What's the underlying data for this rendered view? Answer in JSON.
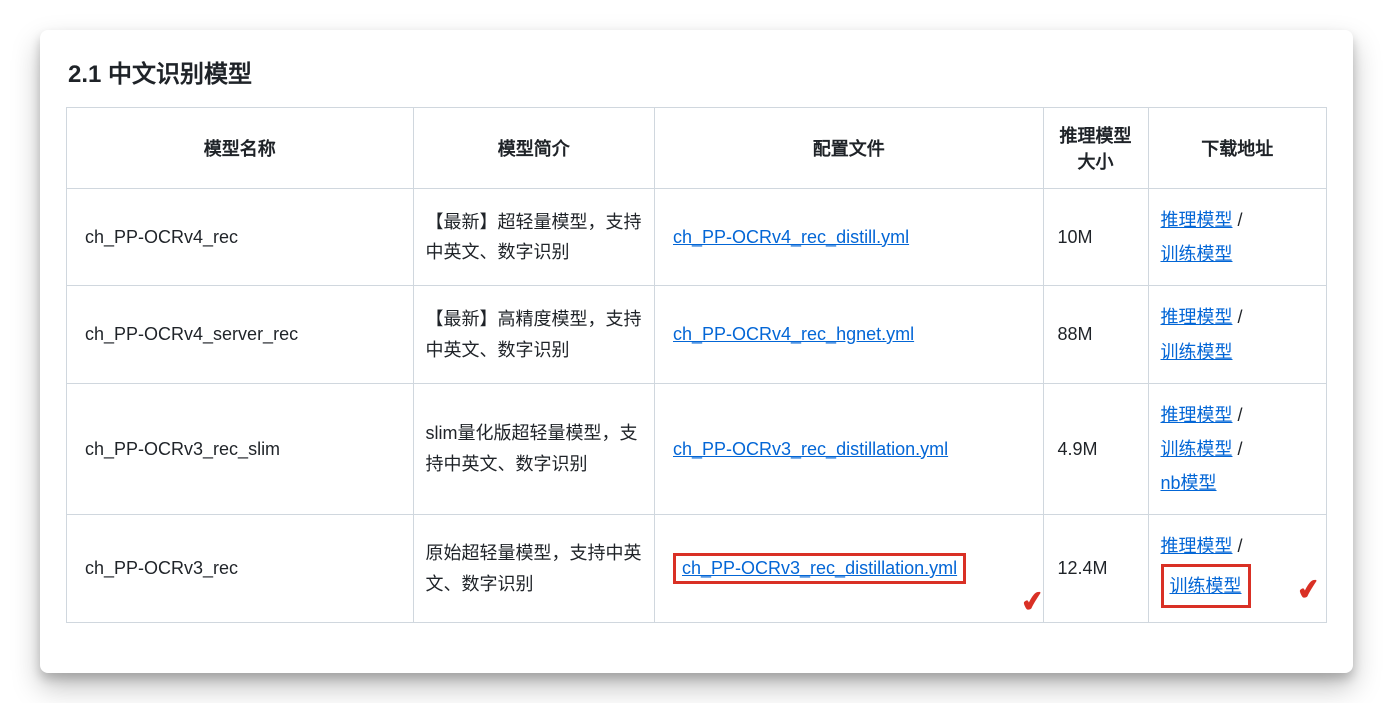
{
  "heading": "2.1 中文识别模型",
  "columns": {
    "c0": "模型名称",
    "c1": "模型简介",
    "c2": "配置文件",
    "c3": "推理模型大小",
    "c4": "下载地址"
  },
  "labels": {
    "infer": "推理模型",
    "train": "训练模型",
    "nb": "nb模型",
    "sep": " / "
  },
  "rows": [
    {
      "name": "ch_PP-OCRv4_rec",
      "intro": "【最新】超轻量模型，支持中英文、数字识别",
      "cfg": "ch_PP-OCRv4_rec_distill.yml",
      "size": "10M",
      "dl": [
        "infer",
        "train"
      ]
    },
    {
      "name": "ch_PP-OCRv4_server_rec",
      "intro": "【最新】高精度模型，支持中英文、数字识别",
      "cfg": "ch_PP-OCRv4_rec_hgnet.yml",
      "size": "88M",
      "dl": [
        "infer",
        "train"
      ]
    },
    {
      "name": "ch_PP-OCRv3_rec_slim",
      "intro": "slim量化版超轻量模型，支持中英文、数字识别",
      "cfg": "ch_PP-OCRv3_rec_distillation.yml",
      "size": "4.9M",
      "dl": [
        "infer",
        "train",
        "nb"
      ]
    },
    {
      "name": "ch_PP-OCRv3_rec",
      "intro": "原始超轻量模型，支持中英文、数字识别",
      "cfg": "ch_PP-OCRv3_rec_distillation.yml",
      "size": "12.4M",
      "dl": [
        "infer",
        "train"
      ],
      "highlightCfg": true,
      "highlightTrain": true
    }
  ],
  "watermark": ""
}
